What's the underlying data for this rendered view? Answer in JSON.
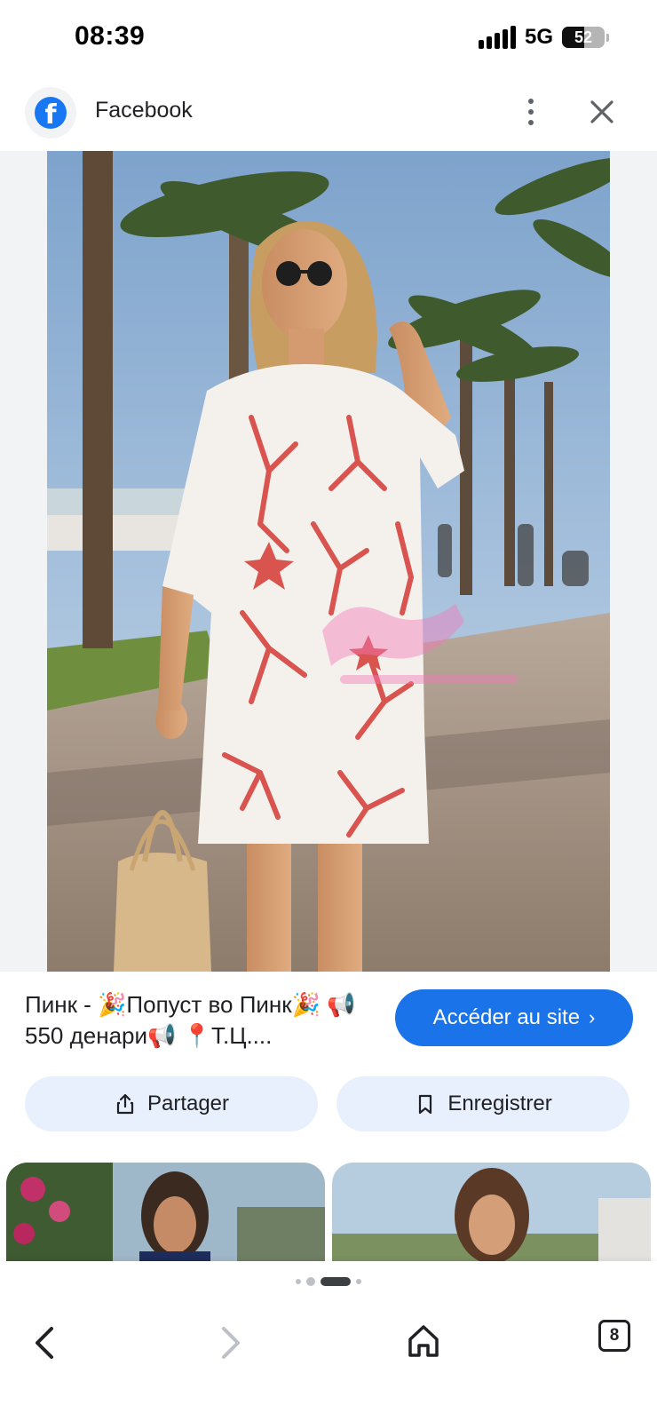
{
  "status_bar": {
    "time": "08:39",
    "network": "5G",
    "battery_level": "52"
  },
  "header": {
    "title": "Facebook",
    "logo_icon": "facebook-logo-icon",
    "menu_icon": "more-vert-icon",
    "close_icon": "close-icon"
  },
  "caption": {
    "text": "Пинк - 🎉Попуст во Пинк🎉 📢550 денари📢 📍Т.Ц...."
  },
  "visit_button": {
    "label": "Accéder au site",
    "icon": "chevron-right-icon"
  },
  "actions": {
    "share_label": "Partager",
    "save_label": "Enregistrer",
    "share_icon": "share-icon",
    "save_icon": "bookmark-icon"
  },
  "bottom_nav": {
    "tab_count": "8",
    "back_icon": "back-arrow-icon",
    "forward_icon": "forward-arrow-icon",
    "home_icon": "home-icon"
  },
  "colors": {
    "accent": "#1a73e8",
    "action_bg": "#e8f0fe",
    "facebook_blue": "#1877f2"
  }
}
